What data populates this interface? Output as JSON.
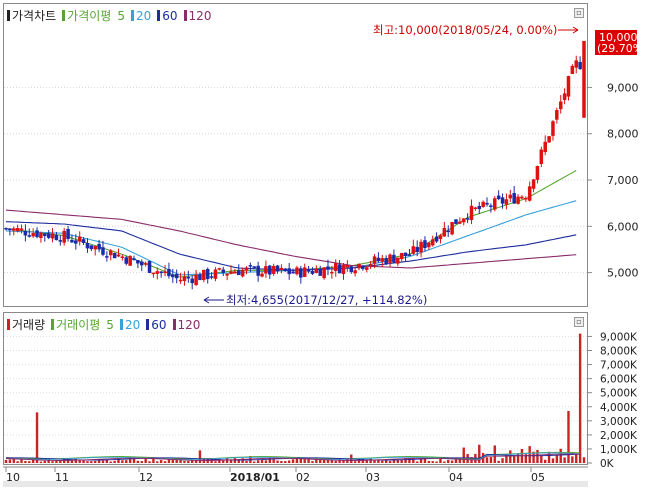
{
  "price_panel": {
    "legend": [
      {
        "label": "가격차트",
        "color": "#222222"
      },
      {
        "label": "가격이평",
        "color": "#55a630"
      },
      {
        "label": "5",
        "color": "#55a630"
      },
      {
        "label": "20",
        "color": "#3aa0d8"
      },
      {
        "label": "60",
        "color": "#1d2c9e"
      },
      {
        "label": "120",
        "color": "#8a2c6a"
      }
    ],
    "high_annotation": "최고:10,000(2018/05/24, 0.00%)",
    "low_annotation": "최저:4,655(2017/12/27, +114.82%)",
    "price_badge": {
      "value": "10,000",
      "change": "(29.70%)",
      "color": "#dd0000"
    }
  },
  "volume_panel": {
    "legend": [
      {
        "label": "거래량",
        "color": "#cc2222"
      },
      {
        "label": "거래이평",
        "color": "#55a630"
      },
      {
        "label": "5",
        "color": "#55a630"
      },
      {
        "label": "20",
        "color": "#3aa0d8"
      },
      {
        "label": "60",
        "color": "#1d2c9e"
      },
      {
        "label": "120",
        "color": "#8a2c6a"
      }
    ]
  },
  "x_axis_labels": [
    "10",
    "11",
    "12",
    "2018/01",
    "02",
    "03",
    "04",
    "05"
  ],
  "chart_data": [
    {
      "type": "line",
      "title": "가격차트",
      "y_ticks": [
        "5,000",
        "6,000",
        "7,000",
        "8,000",
        "9,000"
      ],
      "ylim": [
        4300,
        10500
      ],
      "grid": true,
      "high": {
        "value": 10000,
        "date": "2018/05/24",
        "change": "0.00%"
      },
      "low": {
        "value": 4655,
        "date": "2017/12/27",
        "change": "+114.82%"
      },
      "last_change": "29.70%",
      "categories": [
        "10",
        "11",
        "12",
        "2018/01",
        "02",
        "03",
        "04",
        "05"
      ],
      "series": [
        {
          "name": "가격차트",
          "values": [
            5950,
            5780,
            5350,
            4850,
            5050,
            5000,
            5150,
            5400,
            6300,
            6700,
            10000
          ]
        },
        {
          "name": "5",
          "values": [
            5950,
            5800,
            5400,
            4900,
            5050,
            5050,
            5150,
            5400,
            6200,
            6600,
            7300
          ]
        },
        {
          "name": "20",
          "values": [
            5900,
            5850,
            5550,
            4950,
            5000,
            5050,
            5100,
            5350,
            5800,
            6250,
            6600
          ]
        },
        {
          "name": "60",
          "values": [
            6100,
            6050,
            5900,
            5400,
            5100,
            5050,
            5100,
            5250,
            5450,
            5600,
            5850
          ]
        },
        {
          "name": "120",
          "values": [
            6350,
            6250,
            6150,
            5900,
            5600,
            5350,
            5150,
            5100,
            5200,
            5300,
            5400
          ]
        }
      ]
    },
    {
      "type": "bar",
      "title": "거래량",
      "y_ticks": [
        "0K",
        "1,000K",
        "2,000K",
        "3,000K",
        "4,000K",
        "5,000K",
        "6,000K",
        "7,000K",
        "8,000K",
        "9,000K"
      ],
      "ylim": [
        0,
        9600
      ],
      "grid": true,
      "categories": [
        "10",
        "11",
        "12",
        "2018/01",
        "02",
        "03",
        "04",
        "05"
      ],
      "series": [
        {
          "name": "거래량",
          "values": [
            3600,
            900,
            1100,
            600,
            500,
            400,
            1300,
            2800,
            3000,
            9200
          ]
        }
      ]
    }
  ]
}
